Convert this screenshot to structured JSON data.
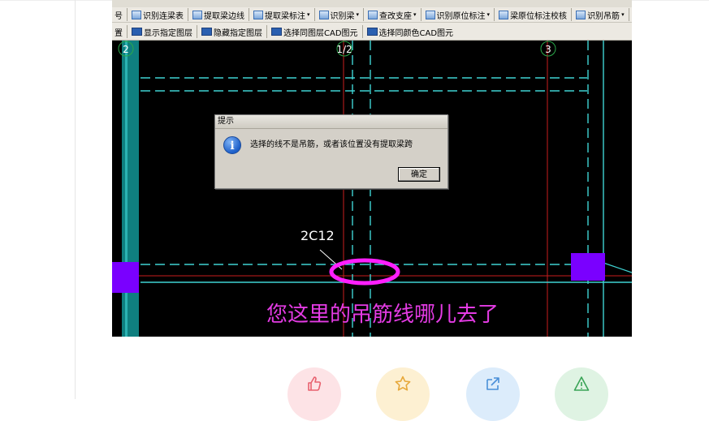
{
  "toolbar_row1": {
    "items": [
      {
        "label": "号",
        "icon": "",
        "dropdown": false
      },
      {
        "label": "识别连梁表",
        "icon": "table-icon",
        "dropdown": false
      },
      {
        "label": "提取梁边线",
        "icon": "extract-line-icon",
        "dropdown": false
      },
      {
        "label": "提取梁标注",
        "icon": "extract-label-icon",
        "dropdown": true
      },
      {
        "label": "识别梁",
        "icon": "recognize-icon",
        "dropdown": true
      },
      {
        "label": "查改支座",
        "icon": "support-icon",
        "dropdown": true
      },
      {
        "label": "识别原位标注",
        "icon": "annotate-icon",
        "dropdown": true
      },
      {
        "label": "梁原位标注校核",
        "icon": "check-icon",
        "dropdown": false
      },
      {
        "label": "识别吊筋",
        "icon": "hanger-icon",
        "dropdown": true
      },
      {
        "label": "识别梁",
        "icon": "recognize-icon",
        "dropdown": false
      }
    ]
  },
  "toolbar_row2": {
    "items": [
      {
        "label": "置",
        "icon": "",
        "cad": false
      },
      {
        "label": "显示指定图层",
        "icon": "cad-icon",
        "cad": true
      },
      {
        "label": "隐藏指定图层",
        "icon": "cad-icon",
        "cad": true
      },
      {
        "label": "选择同图层CAD图元",
        "icon": "cad-icon",
        "cad": true
      },
      {
        "label": "选择同颜色CAD图元",
        "icon": "cad-icon",
        "cad": true
      }
    ]
  },
  "axis_labels": {
    "left": "2",
    "middle": "1/2",
    "right": "3"
  },
  "dialog": {
    "title": "提示",
    "icon": "info-icon",
    "message": "选择的线不是吊筋，或者该位置没有提取梁跨",
    "ok_label": "确定"
  },
  "annotation": {
    "rebar_label": "2C12",
    "note": "您这里的吊筋线哪儿去了"
  },
  "actions": [
    {
      "icon": "thumbs-up-icon",
      "color": "#fde3e6",
      "stroke": "#e8616f"
    },
    {
      "icon": "star-icon",
      "color": "#fdf0d2",
      "stroke": "#e7a83a"
    },
    {
      "icon": "share-icon",
      "color": "#dcecfb",
      "stroke": "#4a8fd8"
    },
    {
      "icon": "warning-icon",
      "color": "#dff3e3",
      "stroke": "#3aa457"
    }
  ],
  "colors": {
    "canvas": "#000000",
    "axis_red": "#c81e1e",
    "beam_cyan": "#3fd3d3",
    "column_purple": "#7a00ff",
    "highlight_magenta": "#ff1fff"
  }
}
